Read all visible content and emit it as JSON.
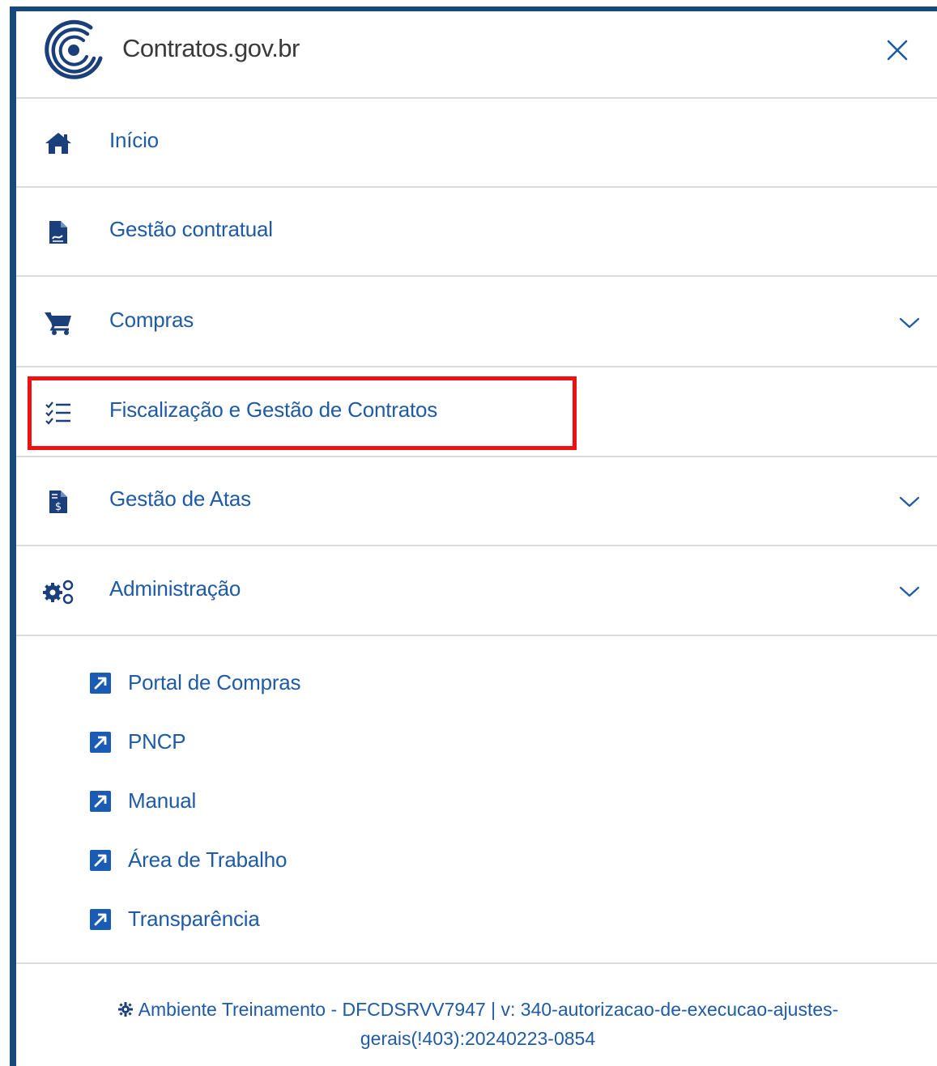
{
  "header": {
    "brand": "Contratos.gov.br",
    "logo_icon": "contratos-spiral-logo",
    "close_icon": "close-icon"
  },
  "menu": {
    "items": [
      {
        "label": "Início",
        "icon": "home-icon",
        "has_submenu": false
      },
      {
        "label": "Gestão contratual",
        "icon": "document-icon",
        "has_submenu": false
      },
      {
        "label": "Compras",
        "icon": "shopping-cart-icon",
        "has_submenu": true
      },
      {
        "label": "Fiscalização e Gestão de Contratos",
        "icon": "checklist-icon",
        "has_submenu": false,
        "highlighted": true
      },
      {
        "label": "Gestão de Atas",
        "icon": "invoice-icon",
        "has_submenu": true
      },
      {
        "label": "Administração",
        "icon": "gears-icon",
        "has_submenu": true
      }
    ]
  },
  "links": {
    "items": [
      {
        "label": "Portal de Compras",
        "icon": "external-link-icon"
      },
      {
        "label": "PNCP",
        "icon": "external-link-icon"
      },
      {
        "label": "Manual",
        "icon": "external-link-icon"
      },
      {
        "label": "Área de Trabalho",
        "icon": "external-link-icon"
      },
      {
        "label": "Transparência",
        "icon": "external-link-icon"
      }
    ]
  },
  "footer": {
    "line1": "Ambiente Treinamento - DFCDSRVV7947 | v: 340-autorizacao-de-execucao-ajustes-",
    "line2": "gerais(!403):20240223-0854",
    "icon": "gear-icon"
  },
  "colors": {
    "accent": "#1f5aa6",
    "icon": "#1a3f7a",
    "border": "#184a79",
    "highlight": "#ee1111",
    "divider": "#dcdcdc"
  }
}
